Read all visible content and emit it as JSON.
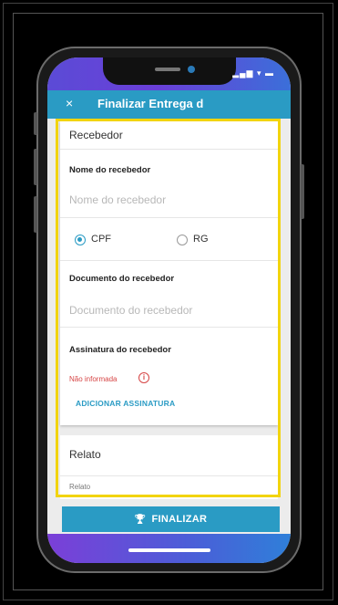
{
  "status": {
    "icons": "▂▄▆ ▾ ▬"
  },
  "appbar": {
    "close_icon": "×",
    "title": "Finalizar Entrega d"
  },
  "recebedor": {
    "section_title": "Recebedor",
    "nome_label": "Nome do recebedor",
    "nome_placeholder": "Nome do recebedor",
    "options": [
      {
        "label": "CPF",
        "selected": true
      },
      {
        "label": "RG",
        "selected": false
      }
    ],
    "documento_label": "Documento do recebedor",
    "documento_placeholder": "Documento do recebedor",
    "assinatura_label": "Assinatura do recebedor",
    "assinatura_status": "Não informada",
    "info_icon": "i",
    "add_signature": "ADICIONAR ASSINATURA"
  },
  "relato": {
    "section_title": "Relato",
    "field_label": "Relato"
  },
  "action": {
    "icon": "🏆",
    "finalize": "FINALIZAR"
  },
  "colors": {
    "primary": "#2a9bc4",
    "highlight": "#f2d40e",
    "error": "#d64545"
  }
}
